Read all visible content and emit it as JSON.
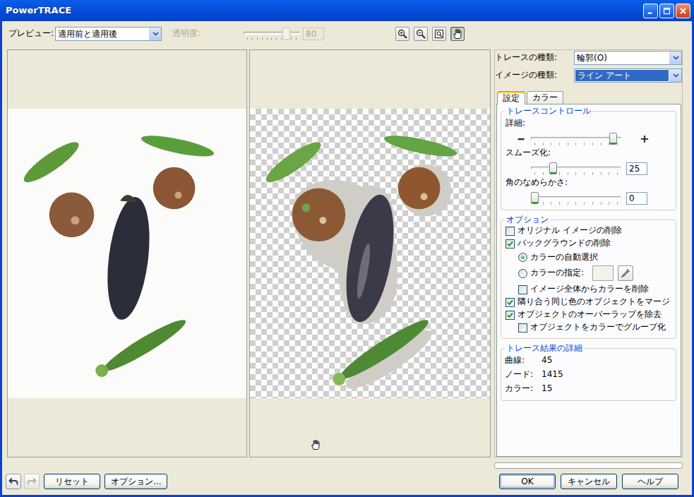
{
  "window": {
    "title": "PowerTRACE"
  },
  "toolbar": {
    "preview_label": "プレビュー:",
    "preview_mode": "適用前と適用後",
    "opacity_label": "透明度:",
    "opacity": {
      "disabled": true,
      "level": 0.8,
      "value": "80"
    }
  },
  "view_tools": [
    {
      "kind": "zoom-in",
      "selected": false
    },
    {
      "kind": "zoom-out",
      "selected": false
    },
    {
      "kind": "fit",
      "selected": false
    },
    {
      "kind": "pan",
      "selected": true
    }
  ],
  "trace_type": {
    "label": "トレースの種類:",
    "value": "輪郭(O)"
  },
  "image_type": {
    "label": "イメージの種類:",
    "value": "ライン アート",
    "focused": true
  },
  "tabs": [
    {
      "label": "設定",
      "selected": true
    },
    {
      "label": "カラー",
      "selected": false
    }
  ],
  "trace_control": {
    "title": "トレースコントロール",
    "sliders": [
      {
        "kind": "range",
        "label": "詳細:",
        "level": 0.95,
        "min_glyph": "━",
        "max_glyph": "+"
      },
      {
        "kind": "value",
        "label": "スムーズ化:",
        "level": 0.22,
        "value": "25"
      },
      {
        "kind": "value",
        "label": "角のなめらかさ:",
        "level": 0,
        "value": "0"
      }
    ]
  },
  "options": {
    "title": "オプション",
    "items": [
      {
        "kind": "checkbox",
        "label": "オリジナル イメージの削除",
        "checked": false
      },
      {
        "kind": "checkbox",
        "label": "バックグラウンドの削除",
        "checked": true
      },
      {
        "kind": "radio",
        "label": "カラーの自動選択",
        "selected": true
      },
      {
        "kind": "radio-pick",
        "label": "カラーの指定:",
        "selected": false
      },
      {
        "kind": "subcheck",
        "label": "イメージ全体からカラーを削除",
        "checked": false
      },
      {
        "kind": "checkbox",
        "label": "隣り合う同じ色のオブジェクトをマージ",
        "checked": true
      },
      {
        "kind": "checkbox",
        "label": "オブジェクトのオーバーラップを除去",
        "checked": true
      },
      {
        "kind": "subcheck",
        "label": "オブジェクトをカラーでグループ化",
        "checked": false
      }
    ]
  },
  "results": {
    "title": "トレース結果の詳細",
    "rows": [
      {
        "label": "曲線:",
        "value": "45"
      },
      {
        "label": "ノード:",
        "value": "1415"
      },
      {
        "label": "カラー:",
        "value": "15"
      }
    ]
  },
  "progress": {
    "level": 0
  },
  "history": [
    {
      "kind": "undo",
      "disabled": false
    },
    {
      "kind": "redo",
      "disabled": true
    }
  ],
  "left_buttons": [
    {
      "label": "リセット"
    },
    {
      "label": "オプション..."
    }
  ],
  "dialog_buttons": [
    {
      "label": "OK",
      "default": true
    },
    {
      "label": "キャンセル",
      "default": false
    },
    {
      "label": "ヘルプ",
      "default": false
    }
  ]
}
